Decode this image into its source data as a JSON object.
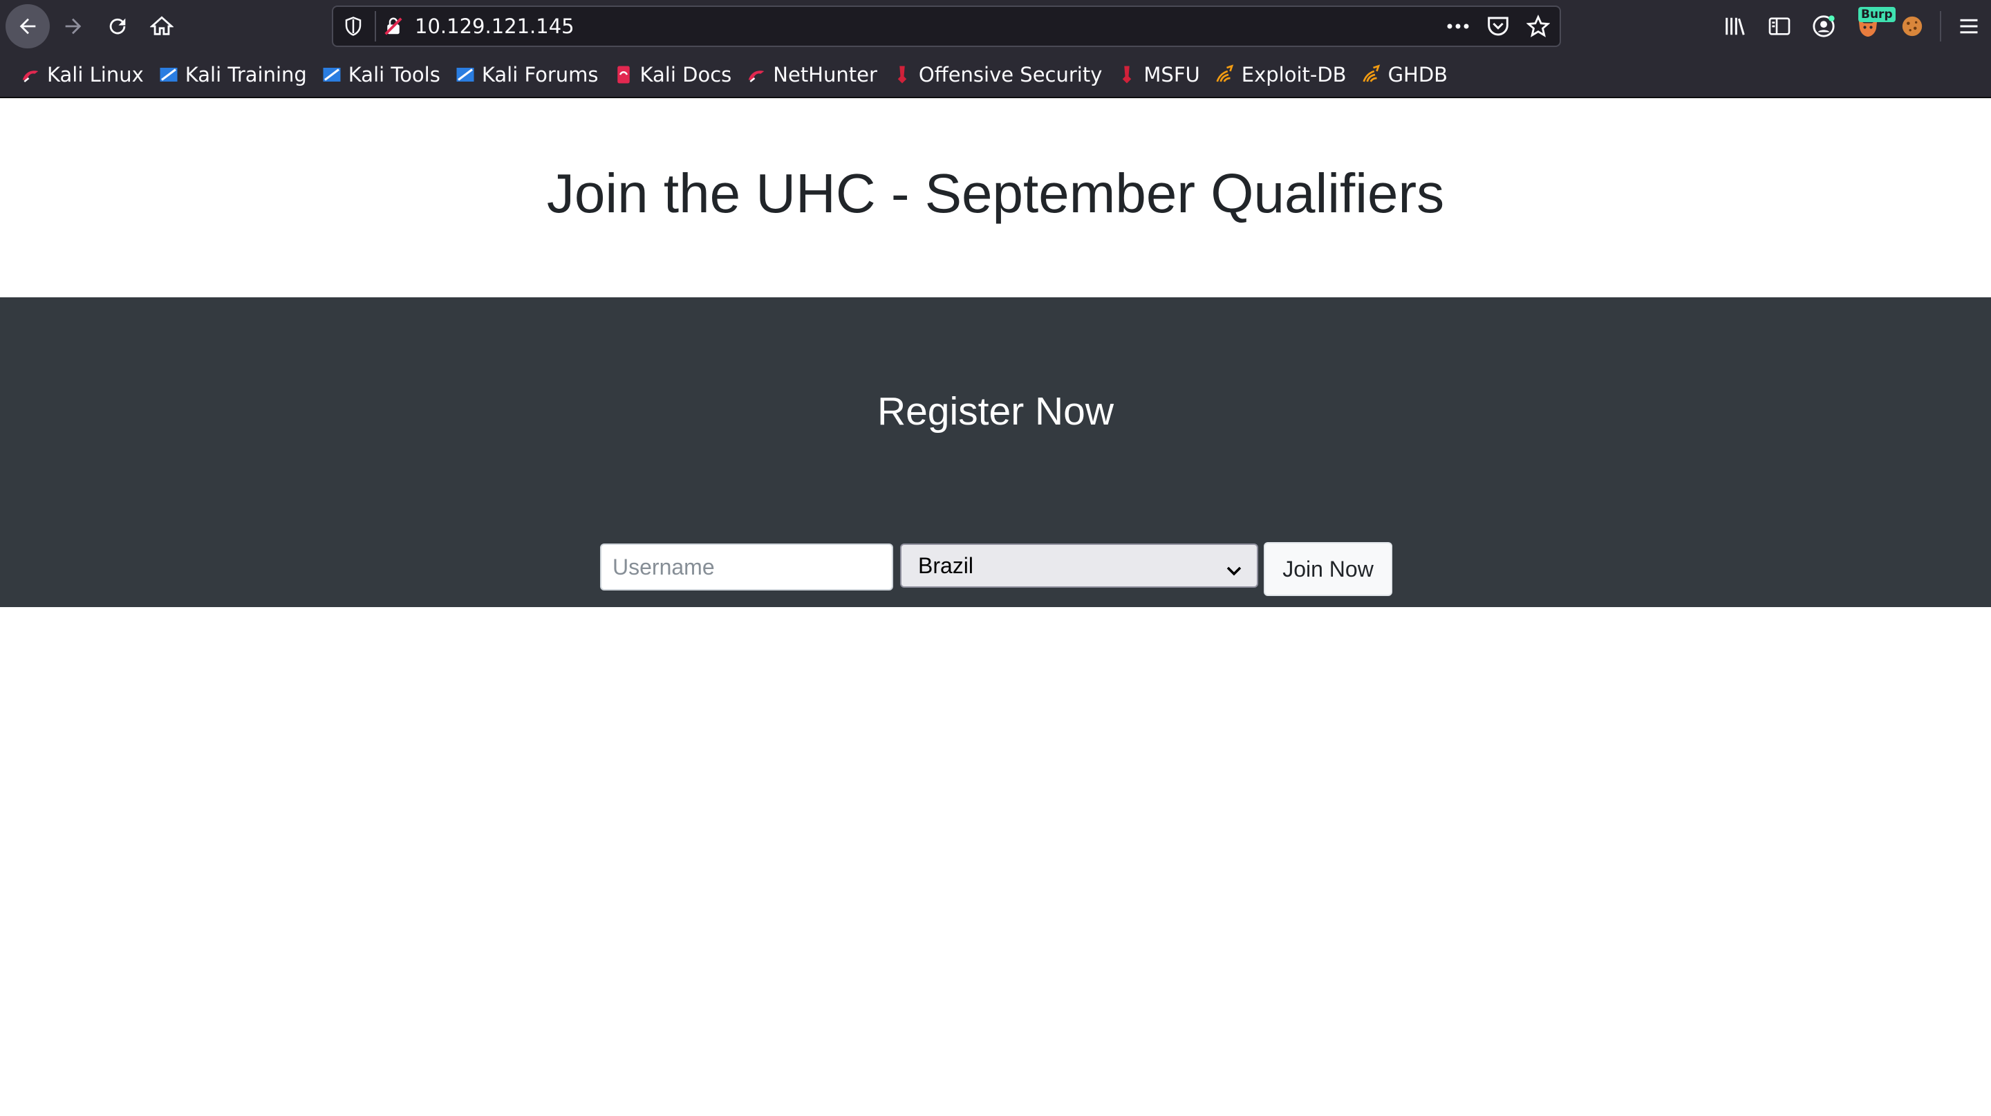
{
  "browser": {
    "url": "10.129.121.145",
    "burp_badge": "Burp",
    "bookmarks": [
      {
        "label": "Kali Linux",
        "icon": "kali-dragon-icon"
      },
      {
        "label": "Kali Training",
        "icon": "kali-training-icon"
      },
      {
        "label": "Kali Tools",
        "icon": "kali-tools-icon"
      },
      {
        "label": "Kali Forums",
        "icon": "kali-forums-icon"
      },
      {
        "label": "Kali Docs",
        "icon": "kali-docs-icon"
      },
      {
        "label": "NetHunter",
        "icon": "nethunter-icon"
      },
      {
        "label": "Offensive Security",
        "icon": "offsec-icon"
      },
      {
        "label": "MSFU",
        "icon": "msfu-icon"
      },
      {
        "label": "Exploit-DB",
        "icon": "exploitdb-icon"
      },
      {
        "label": "GHDB",
        "icon": "ghdb-icon"
      }
    ]
  },
  "page": {
    "title": "Join the UHC - September Qualifiers",
    "register": {
      "heading": "Register Now",
      "username_placeholder": "Username",
      "username_value": "",
      "country_selected": "Brazil",
      "submit_label": "Join Now"
    }
  },
  "colors": {
    "chrome_bg": "#2b2a33",
    "hero_bg": "#343a40",
    "title_text": "#212529"
  }
}
